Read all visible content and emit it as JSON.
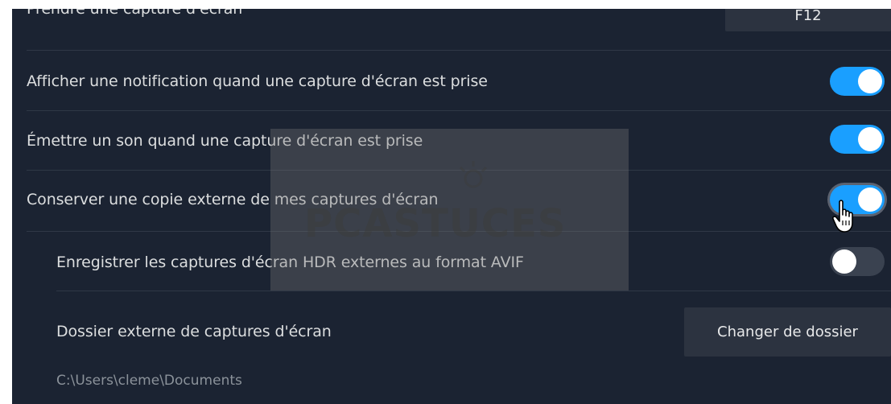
{
  "settings": {
    "screenshot_key": {
      "label": "Prendre une capture d'écran",
      "value": "F12"
    },
    "notify": {
      "label": "Afficher une notification quand une capture d'écran est prise",
      "state": "on"
    },
    "sound": {
      "label": "Émettre un son quand une capture d'écran est prise",
      "state": "on"
    },
    "external_copy": {
      "label": "Conserver une copie externe de mes captures d'écran",
      "state": "on"
    },
    "hdr_avif": {
      "label": "Enregistrer les captures d'écran HDR externes au format AVIF",
      "state": "off"
    },
    "folder": {
      "label": "Dossier externe de captures d'écran",
      "button": "Changer de dossier",
      "path": "C:\\Users\\cleme\\Documents"
    }
  },
  "watermark": {
    "text": "PCASTUCES"
  },
  "colors": {
    "background": "#1b2332",
    "toggle_on": "#1a9fff",
    "toggle_off": "#3a4250",
    "separator": "#2f3846"
  }
}
